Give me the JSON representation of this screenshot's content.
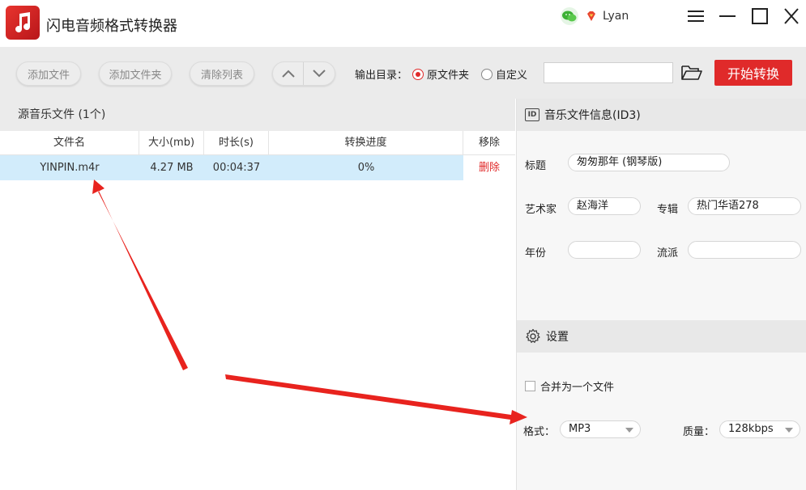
{
  "app": {
    "title": "闪电音频格式转换器",
    "user_name": "Lyan"
  },
  "toolbar": {
    "add_file": "添加文件",
    "add_folder": "添加文件夹",
    "clear_list": "清除列表",
    "output_dir_label": "输出目录：",
    "radio_original": "原文件夹",
    "radio_custom": "自定义",
    "selected_output": "原文件夹",
    "path_value": "",
    "start_label": "开始转换"
  },
  "file_list": {
    "header": "源音乐文件 (1个)",
    "columns": [
      "文件名",
      "大小(mb)",
      "时长(s)",
      "转换进度",
      "移除"
    ],
    "rows": [
      {
        "name": "YINPIN.m4r",
        "size": "4.27 MB",
        "duration": "00:04:37",
        "progress": "0%",
        "remove": "删除"
      }
    ]
  },
  "id3": {
    "section_title": "音乐文件信息(ID3)",
    "title_label": "标题",
    "title_value": "匆匆那年 (钢琴版)",
    "artist_label": "艺术家",
    "artist_value": "赵海洋",
    "album_label": "专辑",
    "album_value": "热门华语278",
    "year_label": "年份",
    "year_value": "",
    "genre_label": "流派",
    "genre_value": ""
  },
  "settings": {
    "section_title": "设置",
    "merge_label": "合并为一个文件",
    "merge_checked": false,
    "format_label": "格式：",
    "format_value": "MP3",
    "quality_label": "质量：",
    "quality_value": "128kbps"
  },
  "colors": {
    "accent": "#e02a2a",
    "selected_row": "#d2ecfb",
    "annotation": "#e8231e"
  }
}
